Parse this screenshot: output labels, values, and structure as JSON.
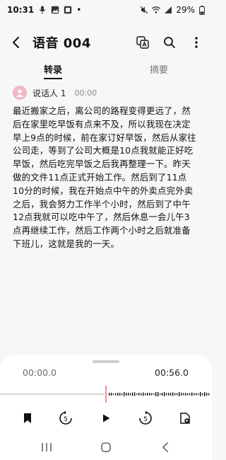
{
  "status": {
    "time": "10:31",
    "battery": "29%",
    "dot": "•"
  },
  "header": {
    "title": "语音 004"
  },
  "tabs": [
    {
      "label": "转录"
    },
    {
      "label": "摘要"
    }
  ],
  "speaker": {
    "name": "说话人 1",
    "time": "00:00"
  },
  "transcript": "最近搬家之后，离公司的路程变得更远了，然后在家里吃早饭有点来不及，所以我现在决定早上9点的时候，前在家订好早饭，然后从家往公司走，等到了公司大概是10点我就能正好吃早饭，然后吃完早饭之后我再整理一下。昨天做的文件11点正式开始工作。然后到了11点10分的时候，我在开始点中午的外卖点完外卖之后，我会努力工作半个小时，然后到了中午12点我就可以吃中午了，然后休息一会儿午3点再继续工作，然后工作两个小时之后就准备下班儿，这就是我的一天。",
  "player": {
    "current_time": "00:00.0",
    "duration": "00:56.0",
    "skip_back_seconds": "5",
    "skip_forward_seconds": "5",
    "progress_fraction": 0.0
  },
  "colors": {
    "accent_red": "#e5484d",
    "avatar_pink": "#f2b8c6"
  }
}
